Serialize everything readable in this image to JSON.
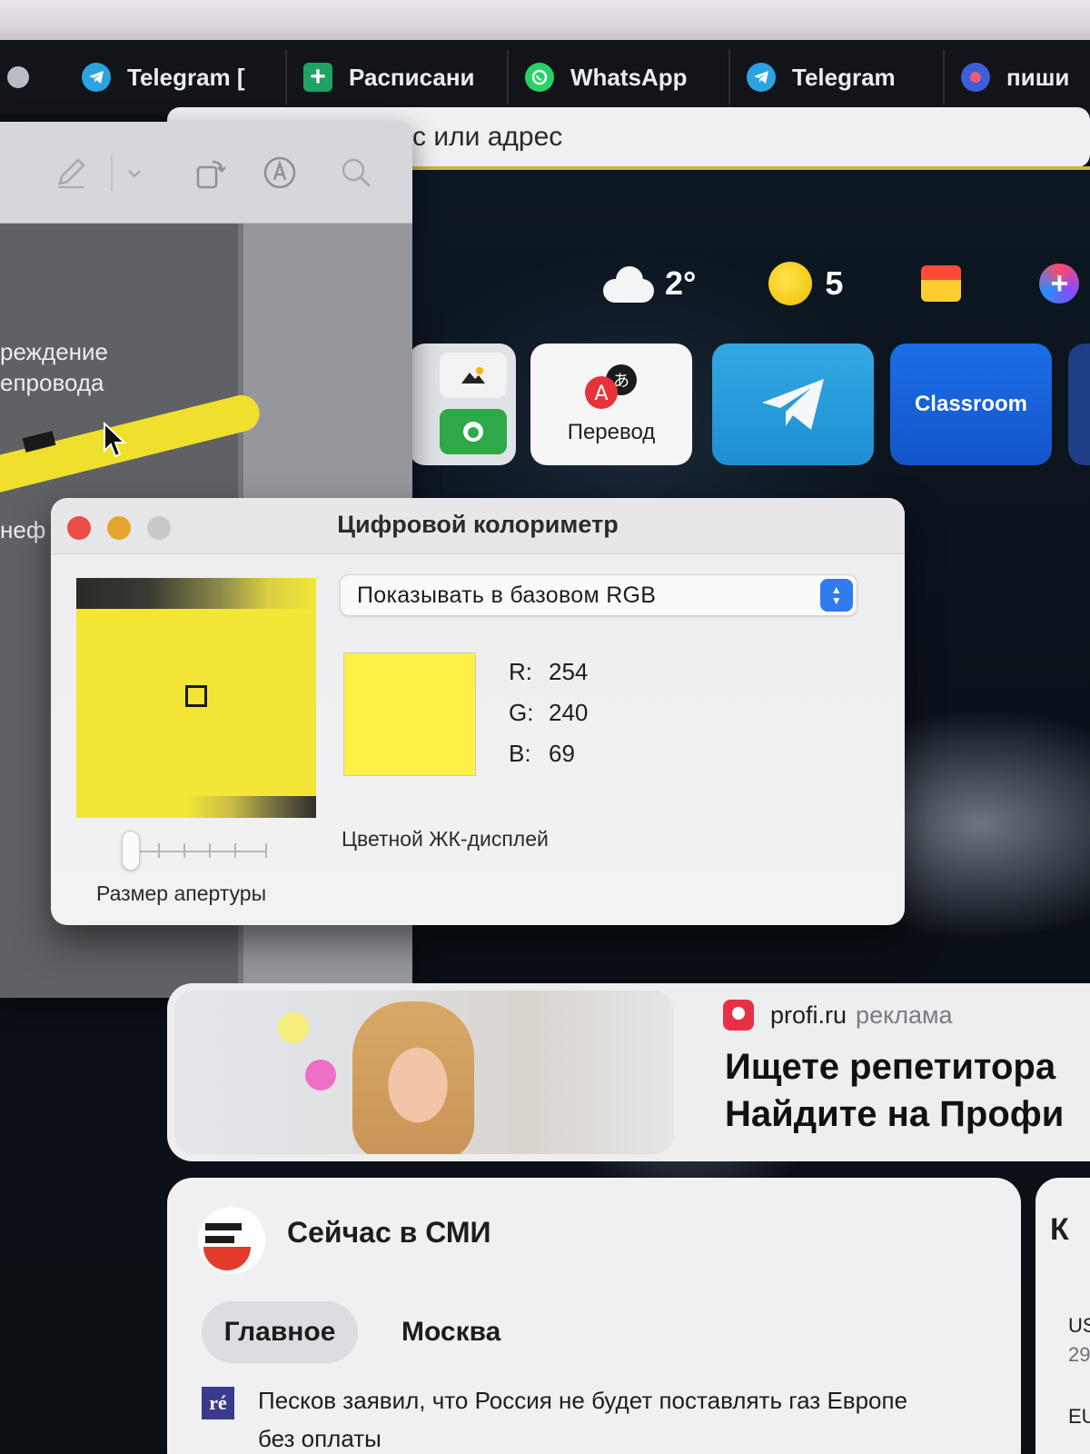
{
  "browser": {
    "tabs": [
      {
        "label": "Telegram [",
        "icon": "telegram-icon"
      },
      {
        "label": "Расписани",
        "icon": "spreadsheet-icon"
      },
      {
        "label": "WhatsApp",
        "icon": "whatsapp-icon"
      },
      {
        "label": "Telegram",
        "icon": "telegram-icon"
      },
      {
        "label": "пиши",
        "icon": "app-icon"
      }
    ],
    "address_text": "с или адрес"
  },
  "widgets": {
    "weather_temp": "2°",
    "traffic_score": "5"
  },
  "tiles": {
    "translate_label": "Перевод",
    "classroom_label": "Classroom"
  },
  "preview_doc": {
    "line1": "реждение",
    "line2": "епровода",
    "line3": "неф"
  },
  "colorimeter": {
    "title": "Цифровой колориметр",
    "mode_select": "Показывать в базовом RGB",
    "r_label": "R:",
    "g_label": "G:",
    "b_label": "B:",
    "r": "254",
    "g": "240",
    "b": "69",
    "swatch_color": "#FEF045",
    "display_profile": "Цветной ЖК-дисплей",
    "aperture_label": "Размер апертуры",
    "aperture_level": 0
  },
  "ad": {
    "site": "profi.ru",
    "tag": "реклама",
    "headline1": "Ищете репетитора",
    "headline2": "Найдите на Профи"
  },
  "news": {
    "title": "Сейчас в СМИ",
    "tab_main": "Главное",
    "tab_moscow": "Москва",
    "source_badge": "ré",
    "headline": "Песков заявил, что Россия не будет поставлять газ Европе без оплаты"
  },
  "side_card": {
    "k": "К",
    "us": "US",
    "num": "29",
    "eu": "EU"
  },
  "colors": {
    "accent_blue": "#2f7bf0",
    "sample_yellow": "#FEF045",
    "close_red": "#ec4d46",
    "minimize_orange": "#e7a52d"
  }
}
